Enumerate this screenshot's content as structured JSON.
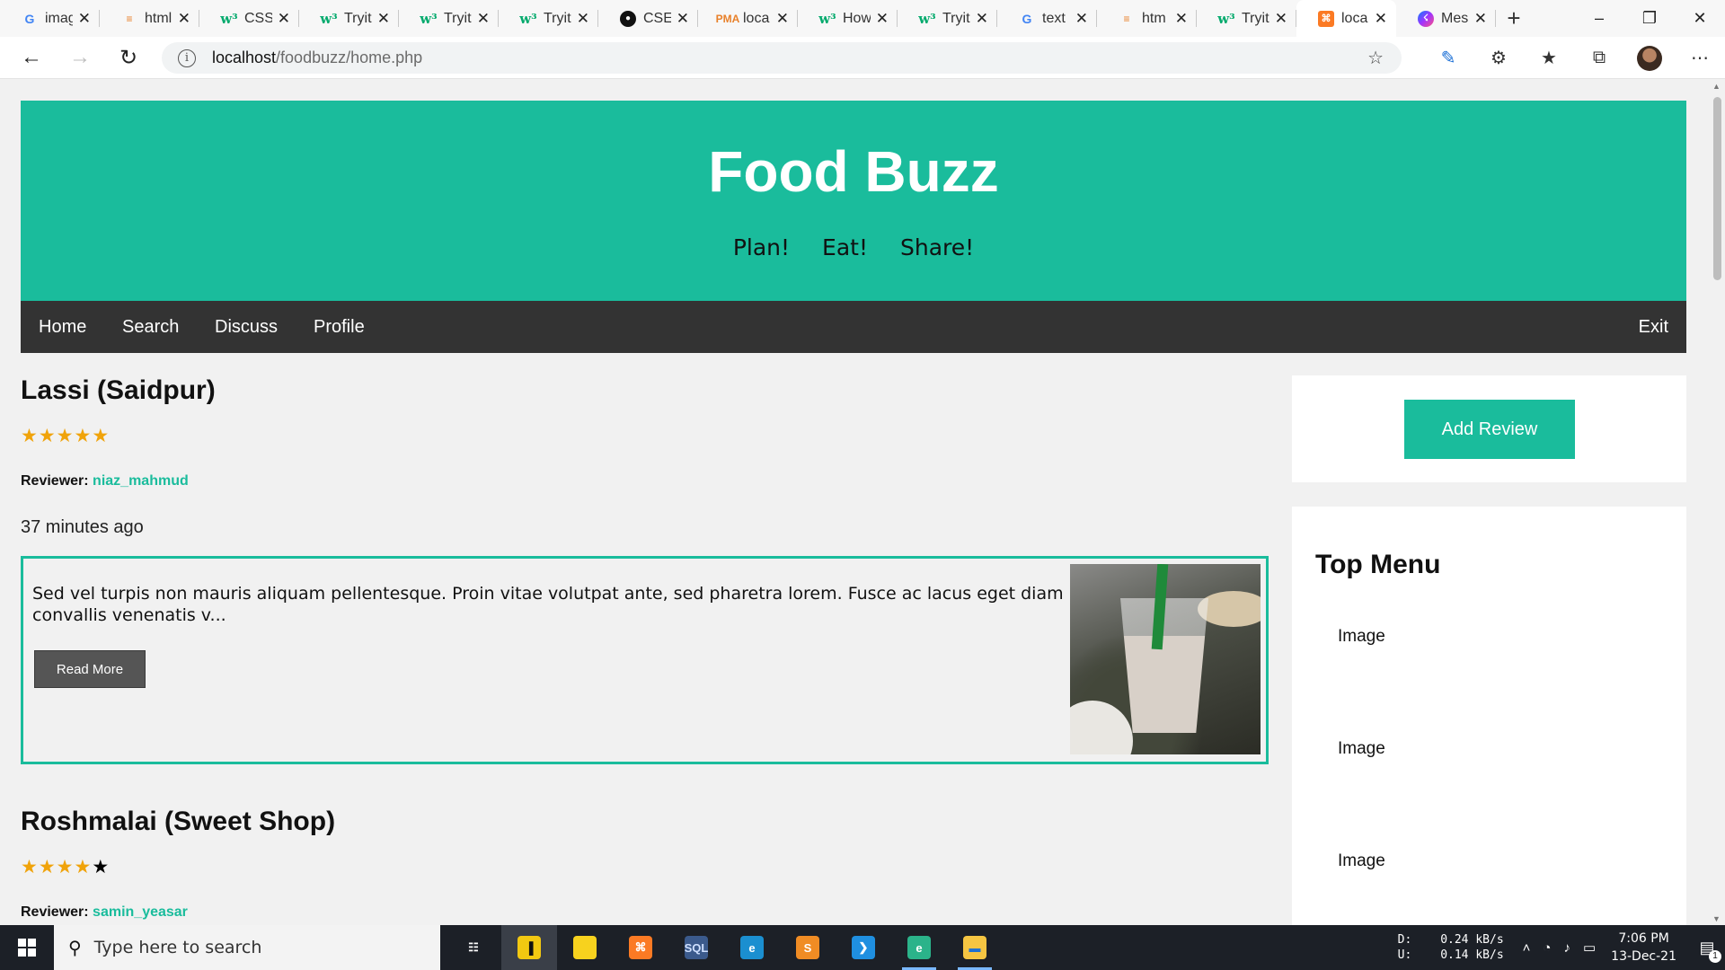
{
  "browser": {
    "tabs": [
      {
        "title": "images",
        "favicon": "google-icon",
        "glyph": "G",
        "cls": "g"
      },
      {
        "title": "html",
        "favicon": "stackoverflow-icon",
        "glyph": "≡",
        "cls": "pma"
      },
      {
        "title": "CSS",
        "favicon": "w3schools-icon",
        "glyph": "w³",
        "cls": "w3"
      },
      {
        "title": "Tryit",
        "favicon": "w3schools-icon",
        "glyph": "w³",
        "cls": "w3"
      },
      {
        "title": "Tryit",
        "favicon": "w3schools-icon",
        "glyph": "w³",
        "cls": "w3"
      },
      {
        "title": "Tryit",
        "favicon": "w3schools-icon",
        "glyph": "w³",
        "cls": "w3"
      },
      {
        "title": "CSE",
        "favicon": "github-icon",
        "glyph": "●",
        "cls": "gh"
      },
      {
        "title": "loca",
        "favicon": "phpmyadmin-icon",
        "glyph": "PMA",
        "cls": "pma"
      },
      {
        "title": "How",
        "favicon": "w3schools-icon",
        "glyph": "w³",
        "cls": "w3"
      },
      {
        "title": "Tryit",
        "favicon": "w3schools-icon",
        "glyph": "w³",
        "cls": "w3"
      },
      {
        "title": "text",
        "favicon": "google-icon",
        "glyph": "G",
        "cls": "g"
      },
      {
        "title": "htm",
        "favicon": "stackoverflow-icon",
        "glyph": "≡",
        "cls": "pma"
      },
      {
        "title": "Tryit",
        "favicon": "w3schools-icon",
        "glyph": "w³",
        "cls": "w3"
      },
      {
        "title": "loca",
        "favicon": "xampp-icon",
        "glyph": "⌘",
        "cls": "xampp",
        "active": true
      },
      {
        "title": "Mes",
        "favicon": "messenger-icon",
        "glyph": "☇",
        "cls": "msg"
      }
    ],
    "new_tab": "+",
    "window_controls": {
      "minimize": "–",
      "restore": "❐",
      "close": "✕"
    },
    "nav": {
      "back": "←",
      "forward": "→",
      "reload": "↻"
    },
    "url_host": "localhost",
    "url_path": "/foodbuzz/home.php",
    "info_glyph": "i",
    "add_favorite_glyph": "☆",
    "toolbar_glyphs": {
      "pen": "✎",
      "extensions": "⚙",
      "favorites": "★",
      "collections": "⧉",
      "more": "⋯"
    }
  },
  "site": {
    "title": "Food Buzz",
    "taglines": [
      "Plan!",
      "Eat!",
      "Share!"
    ],
    "nav": [
      "Home",
      "Search",
      "Discuss",
      "Profile"
    ],
    "exit": "Exit",
    "accent": "#1abc9c"
  },
  "posts": [
    {
      "title": "Lassi (Saidpur)",
      "rating": 5,
      "rating_max": 5,
      "reviewer_label": "Reviewer:",
      "reviewer": "niaz_mahmud",
      "time": "37 minutes ago",
      "excerpt": "Sed vel turpis non mauris aliquam pellentesque. Proin vitae volutpat ante, sed pharetra lorem. Fusce ac lacus eget diam convallis venenatis v...",
      "read_more": "Read More"
    },
    {
      "title": "Roshmalai (Sweet Shop)",
      "rating": 4,
      "rating_max": 5,
      "reviewer_label": "Reviewer:",
      "reviewer": "samin_yeasar"
    }
  ],
  "sidebar": {
    "add_review": "Add Review",
    "top_menu_title": "Top Menu",
    "items": [
      "Image",
      "Image",
      "Image"
    ]
  },
  "taskbar": {
    "search_placeholder": "Type here to search",
    "apps": [
      {
        "name": "task-view",
        "glyph": "☷",
        "color": "#ffffff",
        "bg": "transparent"
      },
      {
        "name": "power-bi",
        "glyph": "▐",
        "color": "#111",
        "bg": "#f2c811",
        "active": true
      },
      {
        "name": "sticky-notes",
        "glyph": "",
        "color": "#111",
        "bg": "#f7d21e"
      },
      {
        "name": "xampp",
        "glyph": "⌘",
        "color": "#fff",
        "bg": "#fb7a24"
      },
      {
        "name": "mysql-workbench",
        "glyph": "SQL",
        "color": "#cfe0ff",
        "bg": "#3b5a8c"
      },
      {
        "name": "edge",
        "glyph": "e",
        "color": "#fff",
        "bg": "#1b8fd0"
      },
      {
        "name": "sublime-text",
        "glyph": "S",
        "color": "#fff",
        "bg": "#f08c24"
      },
      {
        "name": "vscode",
        "glyph": "❯",
        "color": "#fff",
        "bg": "#1f8fe0"
      },
      {
        "name": "edge-dev",
        "glyph": "e",
        "color": "#fff",
        "bg": "#2bb38a",
        "running": true
      },
      {
        "name": "file-explorer",
        "glyph": "▬",
        "color": "#1c6fd1",
        "bg": "#f5c542",
        "running": true
      }
    ],
    "net": {
      "d_label": "D:",
      "d_value": "0.24 kB/s",
      "u_label": "U:",
      "u_value": "0.14 kB/s"
    },
    "tray_glyphs": {
      "chevron": "˄",
      "wifi": "◔",
      "volume": "♪",
      "battery": "▭"
    },
    "time": "7:06 PM",
    "date": "13-Dec-21",
    "notif_glyph": "▤",
    "notif_count": "1"
  }
}
